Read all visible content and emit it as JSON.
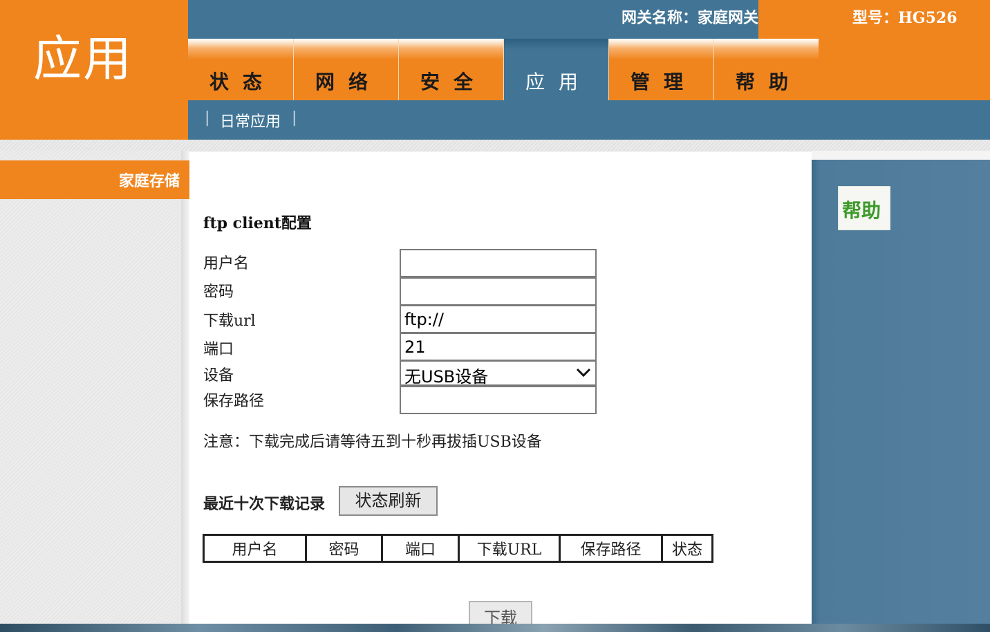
{
  "header": {
    "section_title": "应用",
    "gateway_name": "网关名称：家庭网关",
    "model": "型号：HG526"
  },
  "nav": {
    "tabs": [
      {
        "label": "状态"
      },
      {
        "label": "网络"
      },
      {
        "label": "安全"
      },
      {
        "label": "应用",
        "active": true
      },
      {
        "label": "管理"
      },
      {
        "label": "帮助"
      }
    ]
  },
  "subnav": {
    "separator": "|",
    "item": "日常应用"
  },
  "sidebar": {
    "items": [
      {
        "label": "家庭存储",
        "active": true
      }
    ]
  },
  "help": {
    "label": "帮助"
  },
  "form": {
    "title": "ftp client配置",
    "username_label": "用户名",
    "username_value": "",
    "password_label": "密码",
    "password_value": "",
    "url_label": "下载url",
    "url_value": "ftp://",
    "port_label": "端口",
    "port_value": "21",
    "device_label": "设备",
    "device_value": "无USB设备",
    "save_path_label": "保存路径",
    "save_path_value": "",
    "note": "注意：下载完成后请等待五到十秒再拔插USB设备"
  },
  "records": {
    "label": "最近十次下载记录",
    "refresh_button": "状态刷新",
    "columns": [
      "用户名",
      "密码",
      "端口",
      "下载URL",
      "保存路径",
      "状态"
    ]
  },
  "download_button": "下载",
  "colors": {
    "orange": "#f0851e",
    "blue": "#427595",
    "help_green": "#3d9a2a"
  },
  "icons": {
    "select_arrow": "chevron-down-icon"
  }
}
